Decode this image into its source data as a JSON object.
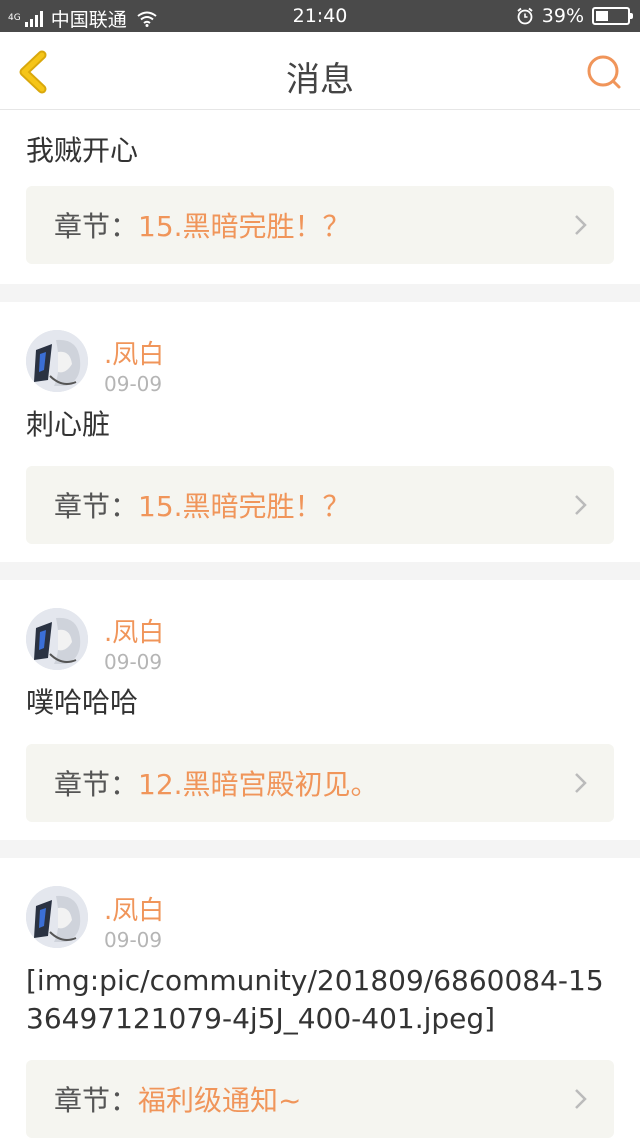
{
  "status_bar": {
    "network": "4G",
    "carrier": "中国联通",
    "time": "21:40",
    "battery": "39%",
    "battery_level": 0.39,
    "icons": [
      "signal-icon",
      "wifi-icon",
      "alarm-icon",
      "battery-icon"
    ]
  },
  "nav": {
    "title": "消息",
    "icons": [
      "back-icon",
      "search-icon"
    ],
    "accent": "#f0955a",
    "back_color": "#f5c518"
  },
  "messages": [
    {
      "username": "",
      "date": "",
      "content": "我贼开心",
      "chapter_label": "章节：",
      "chapter_title": "15.黑暗完胜！？"
    },
    {
      "username": ".凤白",
      "date": "09-09",
      "content": "刺心脏",
      "chapter_label": "章节：",
      "chapter_title": "15.黑暗完胜！？"
    },
    {
      "username": ".凤白",
      "date": "09-09",
      "content": "噗哈哈哈",
      "chapter_label": "章节：",
      "chapter_title": "12.黑暗宫殿初见。"
    },
    {
      "username": ".凤白",
      "date": "09-09",
      "content": "[img:pic/community/201809/6860084-1536497121079-4j5J_400-401.jpeg]",
      "chapter_label": "章节：",
      "chapter_title": "福利级通知~"
    }
  ]
}
